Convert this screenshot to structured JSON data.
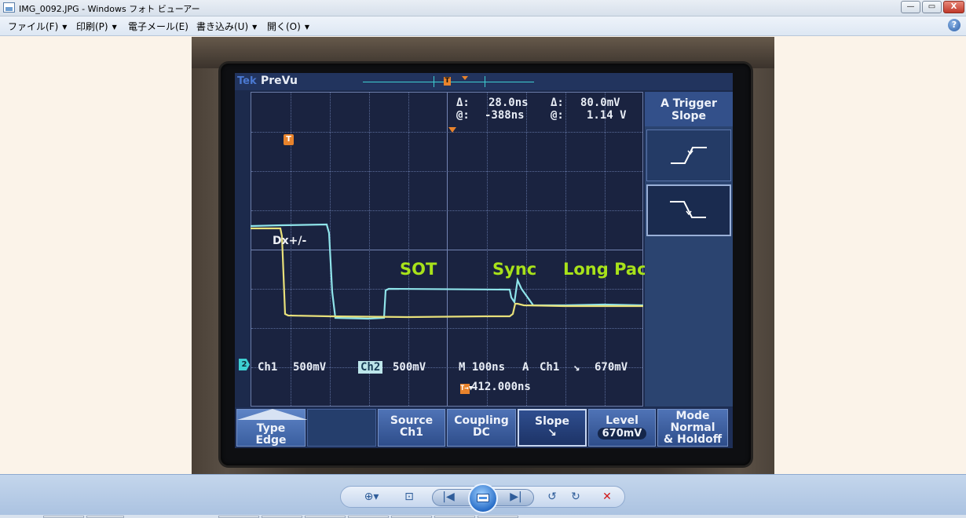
{
  "window": {
    "title": "IMG_0092.JPG - Windows フォト ビューアー",
    "controls": {
      "minimize": "—",
      "maximize": "▭",
      "close": "X"
    }
  },
  "menu": {
    "items": [
      {
        "label": "ファイル(F)",
        "has_dropdown": true
      },
      {
        "label": "印刷(P)",
        "has_dropdown": true
      },
      {
        "label": "電子メール(E)",
        "has_dropdown": false
      },
      {
        "label": "書き込み(U)",
        "has_dropdown": true
      },
      {
        "label": "開く(O)",
        "has_dropdown": true
      }
    ],
    "dropdown_glyph": "▼",
    "help": "?"
  },
  "scope": {
    "brand": "Tek",
    "mode": "PreVu",
    "t_marker": "T",
    "ch2_marker": "2",
    "cursors": {
      "delta_time_label": "Δ:",
      "delta_time": "28.0ns",
      "at_time_label": "@:",
      "at_time": "-388ns",
      "delta_volt_label": "Δ:",
      "delta_volt": "80.0mV",
      "at_volt_label": "@:",
      "at_volt": "1.14 V"
    },
    "annotations": {
      "signal": "Dx+/-",
      "sot": "SOT",
      "sync": "Sync",
      "long_packet": "Long Packet"
    },
    "status": {
      "ch1_label": "Ch1",
      "ch1_scale": "500mV",
      "ch2_label": "Ch2",
      "ch2_scale": "500mV",
      "timebase": "M 100ns",
      "trigger_label": "A",
      "trigger_ch": "Ch1",
      "trigger_slope_glyph": "↘",
      "trigger_level": "670mV",
      "trigger_pos": "412.000ns",
      "trigger_pos_prefix": "T→▼"
    },
    "side_menu": {
      "title_line1": "A Trigger",
      "title_line2": "Slope",
      "options": [
        "rising",
        "falling"
      ],
      "selected": "falling"
    },
    "softkeys": [
      {
        "line1": "Type",
        "line2": "Edge"
      },
      {
        "line1": "",
        "line2": ""
      },
      {
        "line1": "Source",
        "line2": "Ch1"
      },
      {
        "line1": "Coupling",
        "line2": "DC"
      },
      {
        "line1": "Slope",
        "line2": "↘",
        "selected": true
      },
      {
        "line1": "Level",
        "line2": "670mV"
      },
      {
        "line1": "Mode",
        "line2": "Normal",
        "line3": "& Holdoff"
      }
    ],
    "colors": {
      "ch1": "#e8e07a",
      "ch2": "#8fe4ea",
      "annotation": "#a8e21a",
      "trigger": "#e8832c"
    }
  },
  "toolbar": {
    "zoom_icon": "zoom-icon",
    "fit_icon": "actual-size-icon",
    "prev_icon": "previous-icon",
    "slideshow_icon": "slideshow-icon",
    "next_icon": "next-icon",
    "rotate_ccw_icon": "rotate-counterclockwise-icon",
    "rotate_cw_icon": "rotate-clockwise-icon",
    "delete_icon": "delete-icon",
    "zoom_glyph": "⊕▾",
    "fit_glyph": "⊡",
    "prev_glyph": "|◀",
    "next_glyph": "▶|",
    "rotate_ccw_glyph": "↺",
    "rotate_cw_glyph": "↻",
    "delete_glyph": "✕"
  }
}
